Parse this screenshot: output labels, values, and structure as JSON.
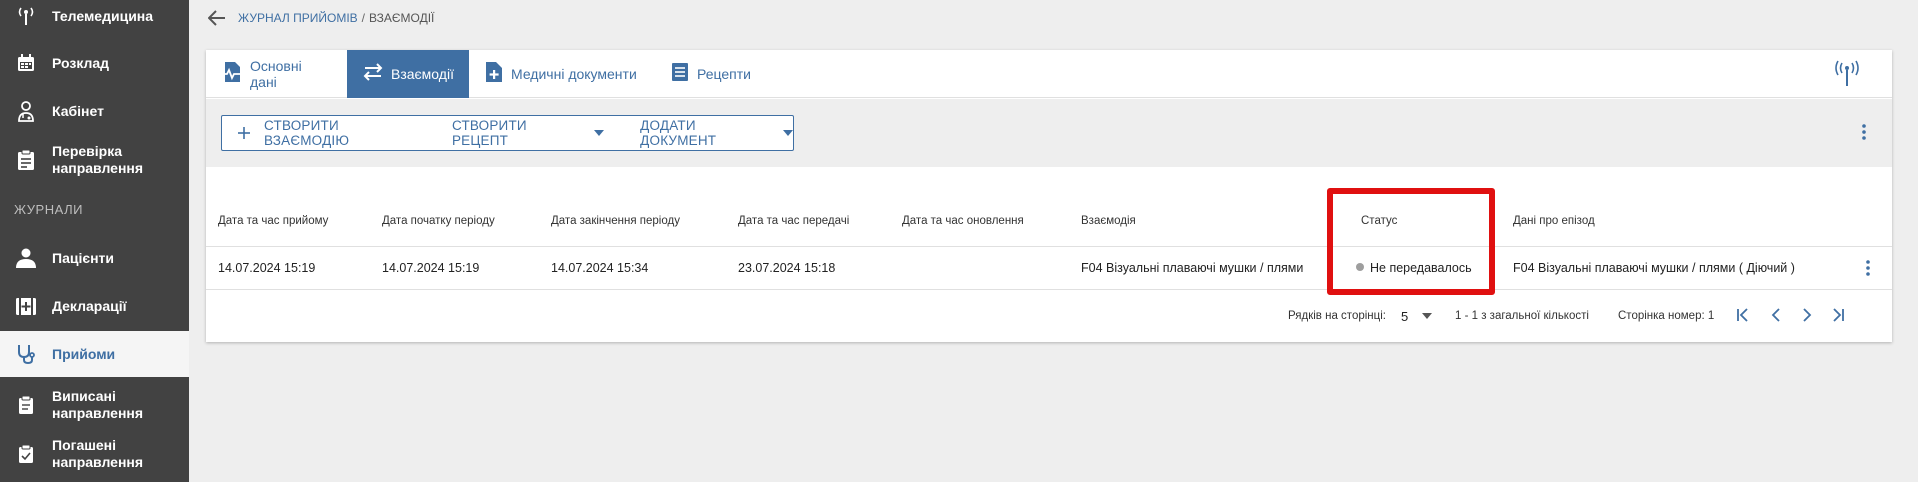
{
  "sidebar": {
    "items": [
      {
        "label": "Телемедицина",
        "icon": "antenna-icon"
      },
      {
        "label": "Розклад",
        "icon": "calendar-icon"
      },
      {
        "label": "Кабінет",
        "icon": "doctor-icon"
      },
      {
        "label": "Перевірка направлення",
        "icon": "clipboard-check-icon"
      },
      {
        "label": "Пацієнти",
        "icon": "person-icon"
      },
      {
        "label": "Декларації",
        "icon": "medical-case-icon"
      },
      {
        "label": "Прийоми",
        "icon": "stethoscope-icon"
      },
      {
        "label": "Виписані направлення",
        "icon": "clipboard-icon"
      },
      {
        "label": "Погашені направлення",
        "icon": "clipboard-done-icon"
      }
    ],
    "section_label": "ЖУРНАЛИ"
  },
  "breadcrumb": {
    "link": "ЖУРНАЛ ПРИЙОМІВ",
    "separator": "/",
    "current": "ВЗАЄМОДІЇ"
  },
  "tabs": [
    {
      "label": "Основні дані",
      "icon": "pulse-doc-icon"
    },
    {
      "label": "Взаємодії",
      "icon": "swap-icon"
    },
    {
      "label": "Медичні документи",
      "icon": "document-plus-icon"
    },
    {
      "label": "Рецепти",
      "icon": "list-icon"
    }
  ],
  "toolbar": {
    "create_interaction": "СТВОРИТИ ВЗАЄМОДІЮ",
    "create_recipe": "СТВОРИТИ РЕЦЕПТ",
    "add_document": "ДОДАТИ ДОКУМЕНТ"
  },
  "table": {
    "headers": [
      "Дата та час прийому",
      "Дата початку періоду",
      "Дата закінчення періоду",
      "Дата та час передачі",
      "Дата та час оновлення",
      "Взаємодія",
      "Статус",
      "Дані про епізод"
    ],
    "rows": [
      {
        "visit": "14.07.2024 15:19",
        "period_start": "14.07.2024 15:19",
        "period_end": "14.07.2024 15:34",
        "transfer": "23.07.2024 15:18",
        "updated": "",
        "interaction": "F04 Візуальні плаваючі мушки / плями",
        "status": "Не передавалось",
        "episode": "F04 Візуальні плаваючі мушки / плями ( Діючий )"
      }
    ]
  },
  "pager": {
    "rows_label": "Рядків на сторінці:",
    "rows_value": "5",
    "range": "1 - 1 з загальної кількості",
    "page_label": "Сторінка номер: 1"
  },
  "colors": {
    "accent": "#3f6fa3",
    "sidebar_bg": "#424242",
    "highlight": "#e01010",
    "status_dot": "#9e9e9e"
  }
}
